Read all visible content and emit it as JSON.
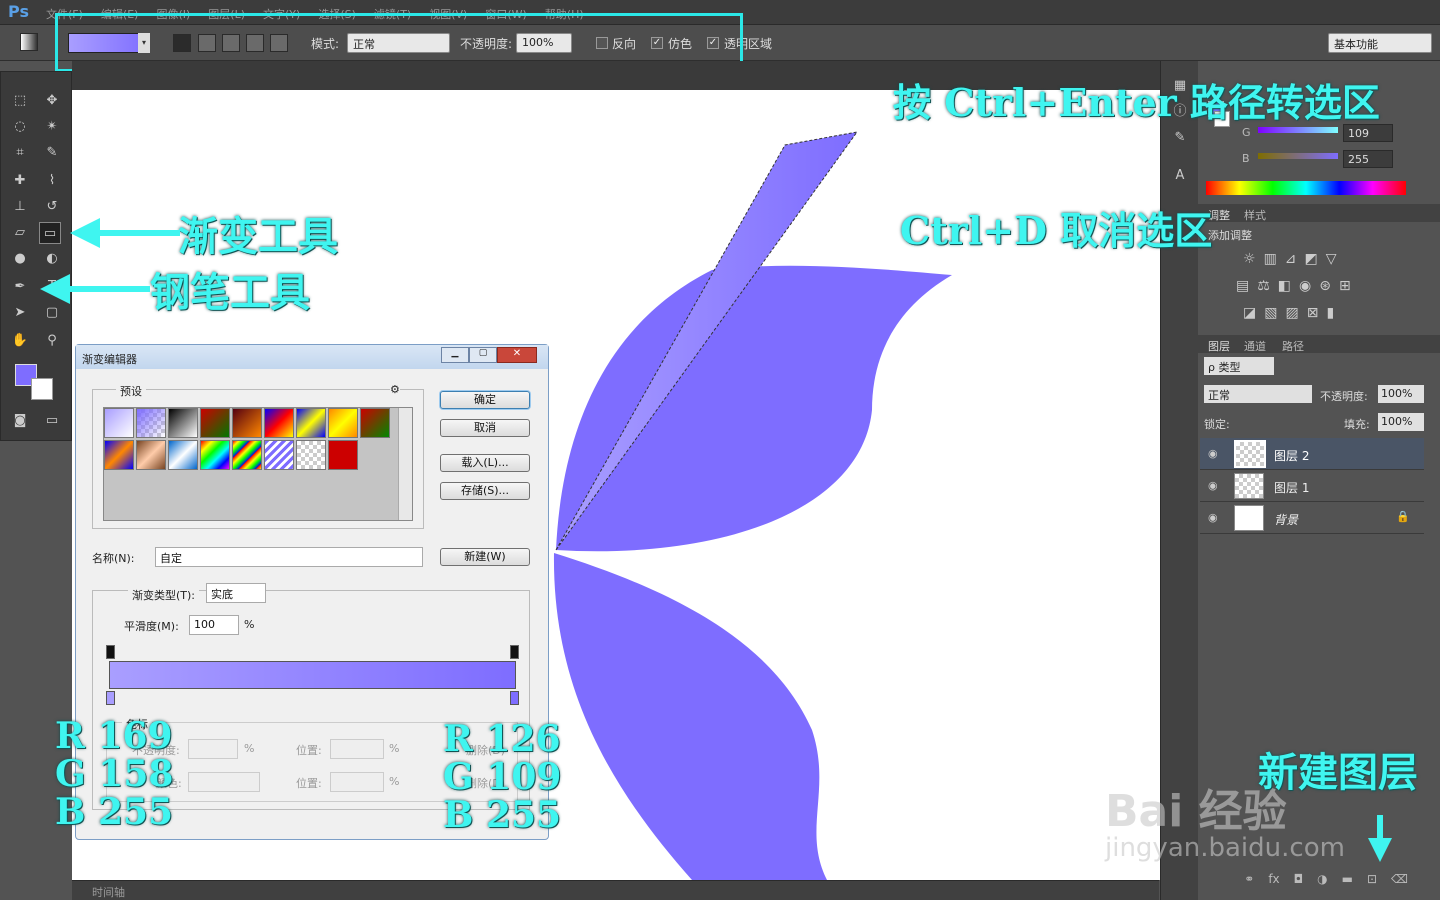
{
  "app": {
    "logo": "Ps"
  },
  "menu": [
    "文件(F)",
    "编辑(E)",
    "图像(I)",
    "图层(L)",
    "文字(Y)",
    "选择(S)",
    "滤镜(T)",
    "视图(V)",
    "窗口(W)",
    "帮助(H)"
  ],
  "options": {
    "mode_label": "模式:",
    "mode_value": "正常",
    "opacity_label": "不透明度:",
    "opacity_value": "100%",
    "reverse_label": "反向",
    "dither_label": "仿色",
    "transparency_label": "透明区域",
    "workspace": "基本功能"
  },
  "annotations": {
    "ctrl_enter": "按 Ctrl+Enter 路径转选区",
    "ctrl_d": "Ctrl+D 取消选区",
    "gradient_tool": "渐变工具",
    "pen_tool": "钢笔工具",
    "new_layer": "新建图层",
    "left_rgb": [
      "R 169",
      "G 158",
      "B 255"
    ],
    "right_rgb": [
      "R 126",
      "G 109",
      "B 255"
    ]
  },
  "color_panel": {
    "g_label": "G",
    "g_value": "109",
    "b_label": "B",
    "b_value": "255"
  },
  "adjust_panel": {
    "tabs": [
      "调整",
      "样式"
    ],
    "add_label": "添加调整"
  },
  "layers_panel": {
    "tabs": [
      "图层",
      "通道",
      "路径"
    ],
    "filter": "ρ 类型",
    "blend": "正常",
    "opacity_label": "不透明度:",
    "opacity_value": "100%",
    "lock_label": "锁定:",
    "fill_label": "填充:",
    "fill_value": "100%",
    "layers": [
      {
        "name": "图层 2"
      },
      {
        "name": "图层 1"
      },
      {
        "name": "背景"
      }
    ]
  },
  "dialog": {
    "title": "渐变编辑器",
    "presets_label": "预设",
    "ok": "确定",
    "cancel": "取消",
    "load": "载入(L)...",
    "save": "存储(S)...",
    "name_label": "名称(N):",
    "name_value": "自定",
    "new_button": "新建(W)",
    "type_label": "渐变类型(T):",
    "type_value": "实底",
    "smooth_label": "平滑度(M):",
    "smooth_value": "100",
    "percent": "%",
    "stops_label": "色标",
    "opacity_label": "不透明度:",
    "color_label": "颜色:",
    "location_label": "位置:",
    "delete_label": "删除(D)"
  },
  "timeline": {
    "label": "时间轴"
  },
  "watermark": {
    "line1": "Bai 经验",
    "line2": "jingyan.baidu.com"
  },
  "colors": {
    "gradient_start": "#a99eff",
    "gradient_end": "#7e6dff",
    "wing": "#7e6dff",
    "annotation": "#3ff5f0"
  }
}
